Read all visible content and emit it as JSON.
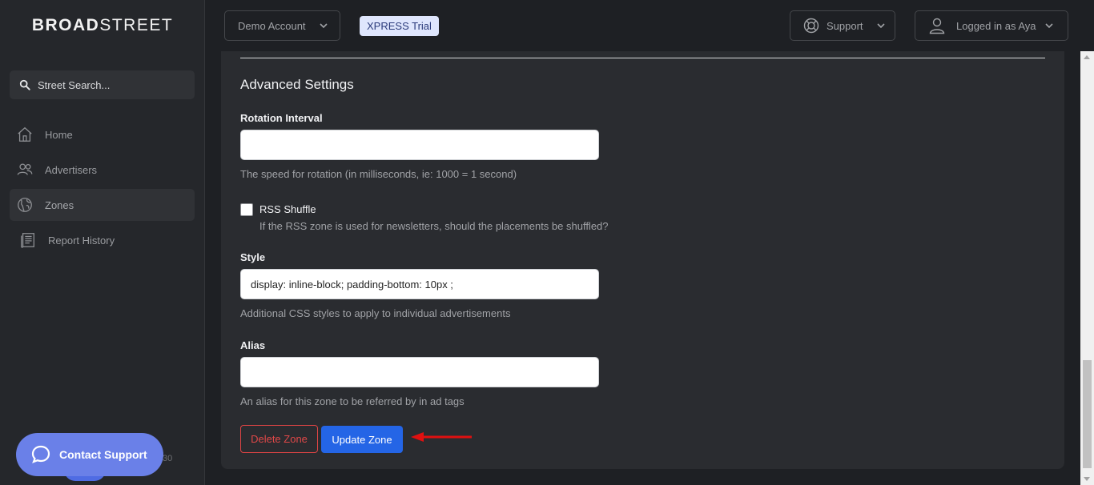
{
  "brand": {
    "part1": "BROAD",
    "part2": "STREET"
  },
  "sidebar": {
    "search_placeholder": "Street Search...",
    "items": [
      {
        "label": "Home",
        "icon": "home-icon"
      },
      {
        "label": "Advertisers",
        "icon": "users-icon"
      },
      {
        "label": "Zones",
        "icon": "globe-icon",
        "active": true
      },
      {
        "label": "Report History",
        "icon": "report-icon"
      }
    ],
    "contact_label": "Contact Support",
    "version_fragment": "30"
  },
  "header": {
    "account_label": "Demo Account",
    "trial_badge": "XPRESS Trial",
    "support_label": "Support",
    "user_label": "Logged in as Aya"
  },
  "form": {
    "section_title": "Advanced Settings",
    "rotation": {
      "label": "Rotation Interval",
      "value": "",
      "help": "The speed for rotation (in milliseconds, ie: 1000 = 1 second)"
    },
    "rss": {
      "label": "RSS Shuffle",
      "checked": false,
      "help": "If the RSS zone is used for newsletters, should the placements be shuffled?"
    },
    "style": {
      "label": "Style",
      "value": "display: inline-block; padding-bottom: 10px ;",
      "help": "Additional CSS styles to apply to individual advertisements"
    },
    "alias": {
      "label": "Alias",
      "value": "",
      "help": "An alias for this zone to be referred by in ad tags"
    },
    "delete_label": "Delete Zone",
    "update_label": "Update Zone"
  },
  "colors": {
    "accent": "#2465e6",
    "danger": "#e04848",
    "annotation_arrow": "#e01010",
    "contact_bubble": "#6a80e8"
  }
}
